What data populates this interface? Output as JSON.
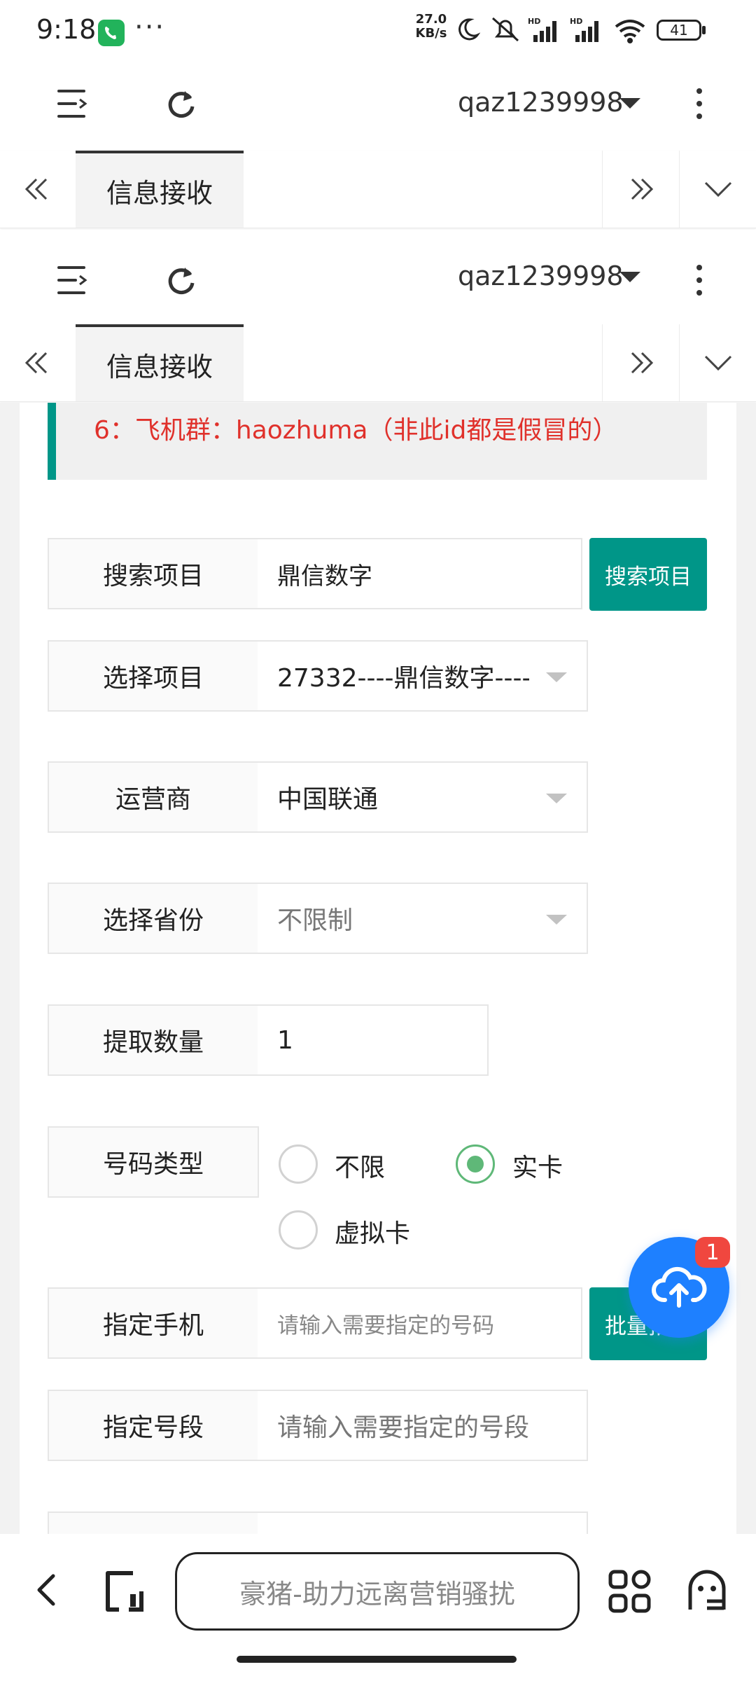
{
  "status_bar": {
    "time": "9:18",
    "net_speed": "27.0 KB/s",
    "battery": "41",
    "icons": [
      "phone-call-icon",
      "more-dots-icon",
      "moon-icon",
      "mute-icon",
      "signal-hd-icon",
      "signal-hd-icon",
      "wifi-icon",
      "battery-icon"
    ]
  },
  "toolbar": {
    "username": "qaz1239998",
    "icons": [
      "menu-toggle-icon",
      "refresh-icon",
      "dropdown-caret-icon",
      "more-vertical-icon"
    ]
  },
  "tabs": {
    "active_tab": "信息接收",
    "icons": [
      "double-left-icon",
      "double-right-icon",
      "chevron-down-icon"
    ]
  },
  "notice": {
    "text": "6：飞机群：haozhuma（非此id都是假冒的）"
  },
  "form": {
    "search_project": {
      "label": "搜索项目",
      "value": "鼎信数字",
      "button": "搜索项目"
    },
    "select_project": {
      "label": "选择项目",
      "value": "27332----鼎信数字----"
    },
    "carrier": {
      "label": "运营商",
      "value": "中国联通"
    },
    "province": {
      "label": "选择省份",
      "value": "不限制"
    },
    "quantity": {
      "label": "提取数量",
      "value": "1"
    },
    "number_type": {
      "label": "号码类型",
      "options": [
        "不限",
        "实卡",
        "虚拟卡"
      ],
      "selected": "实卡"
    },
    "specify_phone": {
      "label": "指定手机",
      "placeholder": "请输入需要指定的号码",
      "button": "批量指定"
    },
    "specify_segment": {
      "label": "指定号段",
      "placeholder": "请输入需要指定的号段"
    }
  },
  "fab": {
    "badge": "1",
    "icon": "cloud-upload-icon"
  },
  "bottom_bar": {
    "search_text": "豪猪-助力远离营销骚扰",
    "icons": [
      "back-arrow-icon",
      "tabs-icon",
      "apps-grid-icon",
      "ghost-icon"
    ]
  }
}
